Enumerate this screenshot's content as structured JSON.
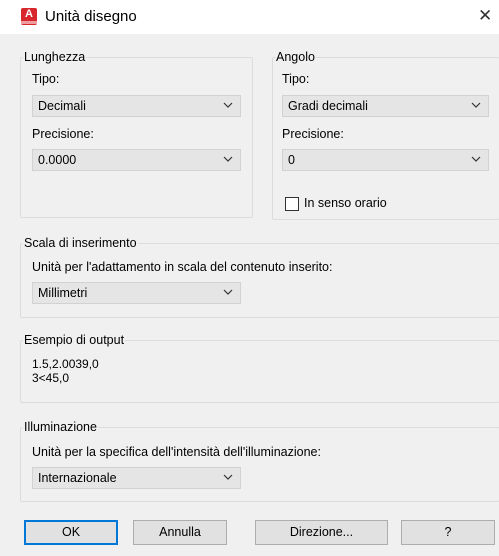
{
  "window": {
    "title": "Unità disegno",
    "app_icon": "autocad-icon",
    "close_glyph": "✕"
  },
  "length": {
    "group_label": "Lunghezza",
    "type_label": "Tipo:",
    "type_value": "Decimali",
    "precision_label": "Precisione:",
    "precision_value": "0.0000"
  },
  "angle": {
    "group_label": "Angolo",
    "type_label": "Tipo:",
    "type_value": "Gradi decimali",
    "precision_label": "Precisione:",
    "precision_value": "0",
    "clockwise_label": "In senso orario",
    "clockwise_checked": false
  },
  "insertion": {
    "group_label": "Scala di inserimento",
    "desc": "Unità per l'adattamento in scala del contenuto inserito:",
    "value": "Millimetri"
  },
  "output": {
    "group_label": "Esempio di output",
    "line1": "1.5,2.0039,0",
    "line2": "3<45,0"
  },
  "lighting": {
    "group_label": "Illuminazione",
    "desc": "Unità per la specifica dell'intensità dell'illuminazione:",
    "value": "Internazionale"
  },
  "buttons": {
    "ok": "OK",
    "cancel": "Annulla",
    "direction": "Direzione...",
    "help": "?"
  },
  "colors": {
    "accent": "#0078d7",
    "app_icon": "#d8262d"
  }
}
